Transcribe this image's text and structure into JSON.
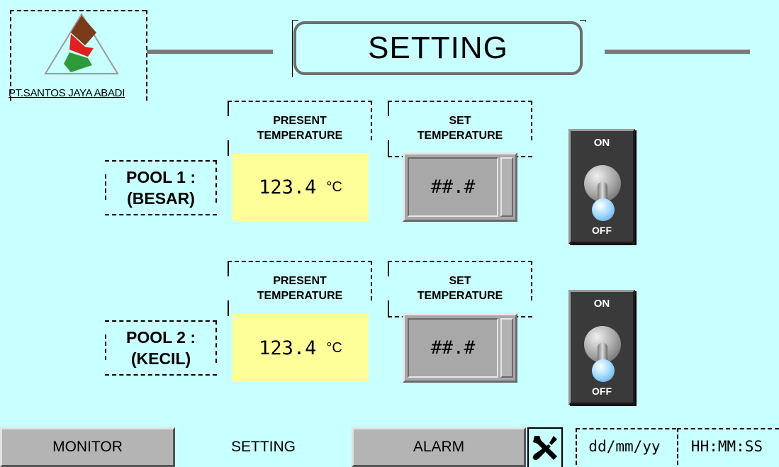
{
  "brand": {
    "company": "PT.SANTOS JAYA ABADI"
  },
  "header": {
    "title": "SETTING"
  },
  "pools": [
    {
      "label_line1": "POOL 1 :",
      "label_line2": "(BESAR)",
      "present_header_1": "PRESENT",
      "present_header_2": "TEMPERATURE",
      "set_header_1": "SET",
      "set_header_2": "TEMPERATURE",
      "present_value": "123.4",
      "unit": "°C",
      "set_value": "##.#",
      "switch_on": "ON",
      "switch_off": "OFF"
    },
    {
      "label_line1": "POOL 2 :",
      "label_line2": "(KECIL)",
      "present_header_1": "PRESENT",
      "present_header_2": "TEMPERATURE",
      "set_header_1": "SET",
      "set_header_2": "TEMPERATURE",
      "present_value": "123.4",
      "unit": "°C",
      "set_value": "##.#",
      "switch_on": "ON",
      "switch_off": "OFF"
    }
  ],
  "nav": {
    "monitor": "MONITOR",
    "setting": "SETTING",
    "alarm": "ALARM",
    "tools_icon": "tools-icon"
  },
  "status": {
    "date": "dd/mm/yy",
    "time": "HH:MM:SS"
  },
  "colors": {
    "background": "#c8ffff",
    "present_field": "#ffff99",
    "set_field": "#a8a8a8",
    "logo_brown": "#7a3b1a",
    "logo_red": "#e02020",
    "logo_green": "#2e9a3a"
  }
}
